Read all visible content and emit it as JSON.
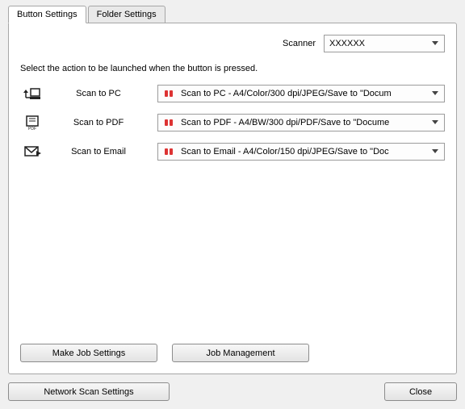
{
  "tabs": {
    "button_settings": "Button Settings",
    "folder_settings": "Folder Settings"
  },
  "scanner": {
    "label": "Scanner",
    "value": "XXXXXX"
  },
  "description": "Select the action to be launched when the button is pressed.",
  "rows": [
    {
      "label": "Scan to PC",
      "job": "Scan to PC - A4/Color/300 dpi/JPEG/Save to \"Docum"
    },
    {
      "label": "Scan to PDF",
      "job": "Scan to PDF - A4/BW/300 dpi/PDF/Save to \"Docume"
    },
    {
      "label": "Scan to Email",
      "job": "Scan to Email - A4/Color/150 dpi/JPEG/Save to \"Doc"
    }
  ],
  "buttons": {
    "make_job_settings": "Make Job Settings",
    "job_management": "Job Management",
    "network_scan_settings": "Network Scan Settings",
    "close": "Close"
  }
}
